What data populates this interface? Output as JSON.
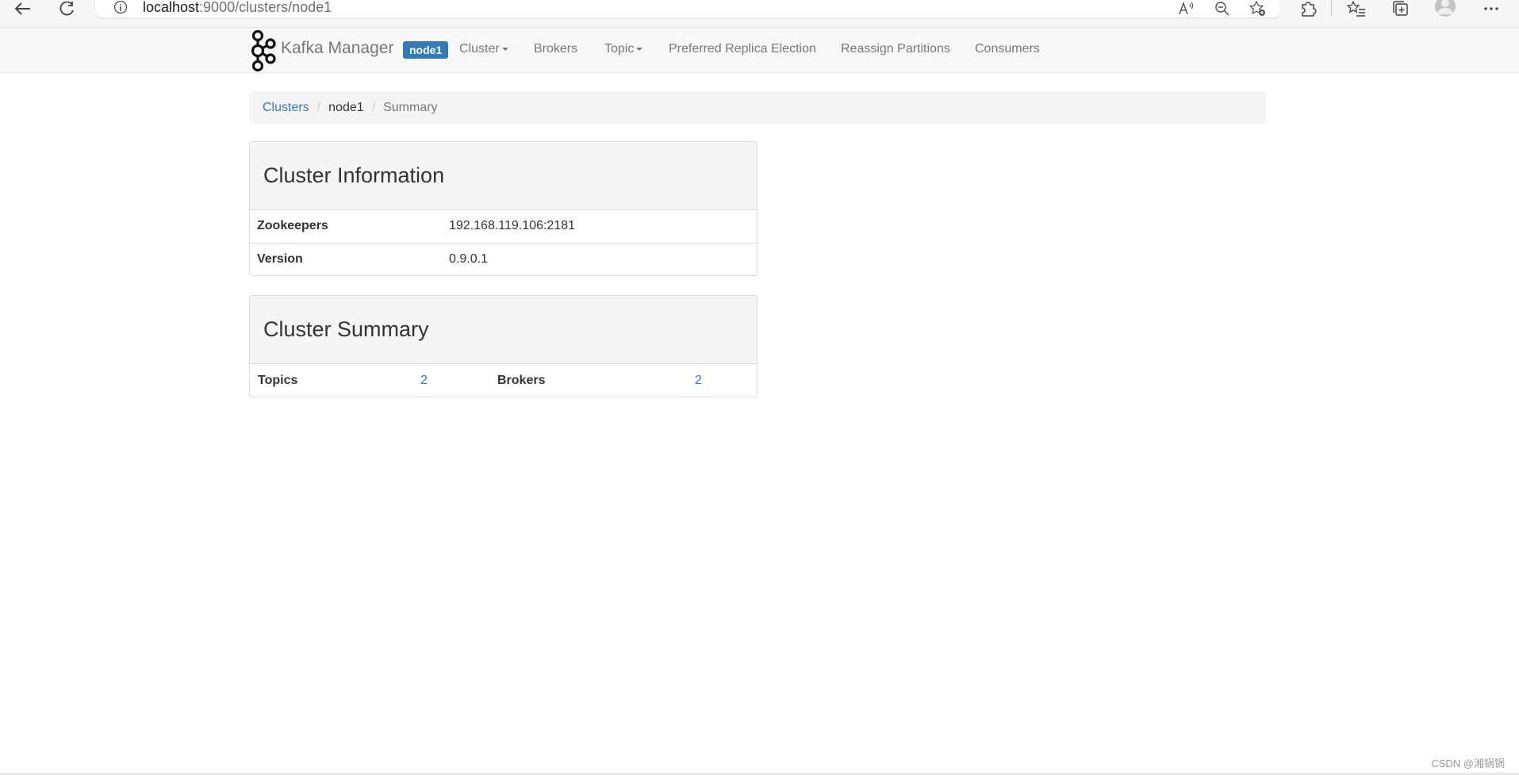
{
  "browser": {
    "url_host": "localhost",
    "url_path": ":9000/clusters/node1"
  },
  "navbar": {
    "brand": "Kafka Manager",
    "cluster_badge": "node1",
    "items": [
      {
        "label": "Cluster",
        "dropdown": true
      },
      {
        "label": "Brokers",
        "dropdown": false
      },
      {
        "label": "Topic",
        "dropdown": true
      },
      {
        "label": "Preferred Replica Election",
        "dropdown": false
      },
      {
        "label": "Reassign Partitions",
        "dropdown": false
      },
      {
        "label": "Consumers",
        "dropdown": false
      }
    ]
  },
  "breadcrumb": {
    "root": "Clusters",
    "cluster": "node1",
    "current": "Summary"
  },
  "cluster_information": {
    "title": "Cluster Information",
    "rows": [
      {
        "label": "Zookeepers",
        "value": "192.168.119.106:2181"
      },
      {
        "label": "Version",
        "value": "0.9.0.1"
      }
    ]
  },
  "cluster_summary": {
    "title": "Cluster Summary",
    "topics_label": "Topics",
    "topics_value": "2",
    "brokers_label": "Brokers",
    "brokers_value": "2"
  },
  "watermark": "CSDN @湘锅锅",
  "colors": {
    "link": "#337ab7",
    "badge": "#337ab7",
    "navbar_bg": "#f8f8f8",
    "panel_heading_bg": "#f5f5f5"
  }
}
